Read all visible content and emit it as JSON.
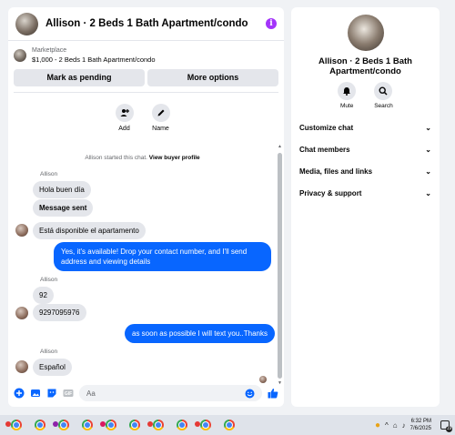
{
  "chat": {
    "title": "Allison · 2 Beds 1 Bath Apartment/condo",
    "listing": {
      "source": "Marketplace",
      "price_title": "$1,000 - 2 Beds 1 Bath Apartment/condo",
      "pending_label": "Mark as pending",
      "options_label": "More options"
    },
    "quick_actions": [
      {
        "label": "Add",
        "icon": "add-person-icon"
      },
      {
        "label": "Name",
        "icon": "pencil-icon"
      }
    ],
    "started_text": "Allison started this chat.",
    "started_link": "View buyer profile",
    "sender": "Allison",
    "messages": {
      "m1": "Hola buen día",
      "m2": "Message sent",
      "m3": "Está disponible el apartamento",
      "m4": "Yes, it's available! Drop your contact number, and I'll send address and viewing details",
      "m5": "92",
      "m6": "9297095976",
      "m7": "as soon as possible I will text you..Thanks",
      "m8": "Español"
    },
    "composer": {
      "placeholder": "Aa"
    },
    "accent_color": "#0866ff"
  },
  "details": {
    "name": "Allison · 2 Beds 1 Bath Apartment/condo",
    "actions": [
      {
        "label": "Mute",
        "icon": "bell-icon"
      },
      {
        "label": "Search",
        "icon": "search-icon"
      }
    ],
    "sections": [
      {
        "label": "Customize chat"
      },
      {
        "label": "Chat members"
      },
      {
        "label": "Media, files and links"
      },
      {
        "label": "Privacy & support"
      }
    ]
  },
  "taskbar": {
    "time": "6:32 PM",
    "date": "7/6/2025",
    "notification_count": "19"
  }
}
